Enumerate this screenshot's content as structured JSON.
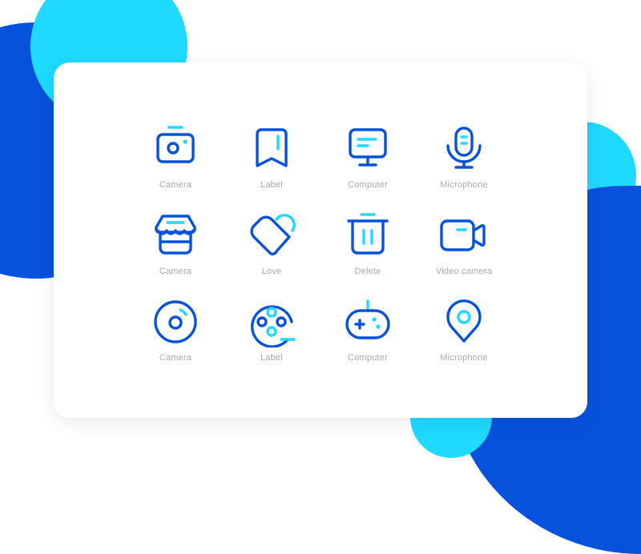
{
  "colors": {
    "primary": "#0652dd",
    "accent": "#1fd9ff",
    "label": "#a4a9b3",
    "card": "#ffffff"
  },
  "icons": [
    {
      "name": "camera",
      "label": "Camera"
    },
    {
      "name": "bookmark",
      "label": "Label"
    },
    {
      "name": "computer",
      "label": "Computer"
    },
    {
      "name": "microphone",
      "label": "Microphone"
    },
    {
      "name": "store",
      "label": "Camera"
    },
    {
      "name": "heart",
      "label": "Love"
    },
    {
      "name": "trash",
      "label": "Delete"
    },
    {
      "name": "video-camera",
      "label": "Video camera"
    },
    {
      "name": "disc",
      "label": "Camera"
    },
    {
      "name": "film-reel",
      "label": "Label"
    },
    {
      "name": "gamepad",
      "label": "Computer"
    },
    {
      "name": "location-pin",
      "label": "Microphone"
    }
  ]
}
